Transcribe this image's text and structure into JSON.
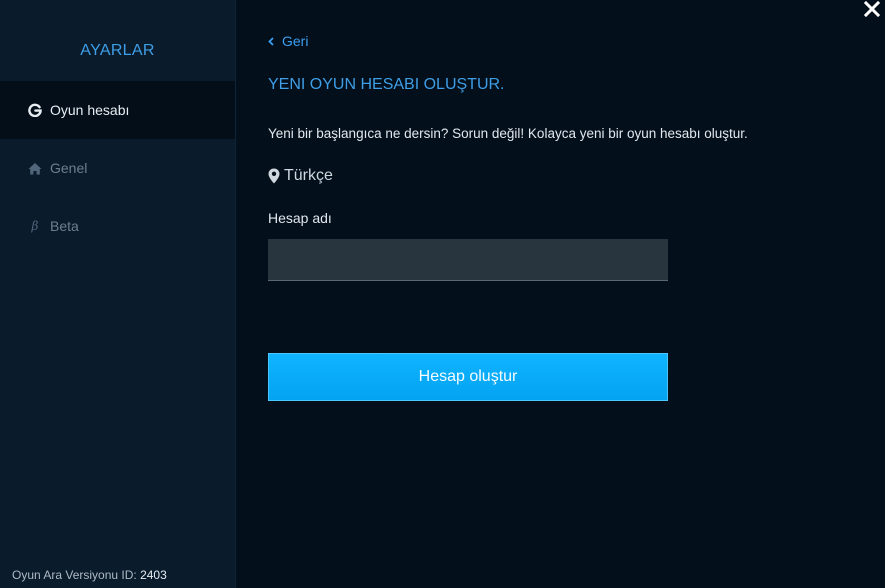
{
  "sidebar": {
    "title": "AYARLAR",
    "items": [
      {
        "label": "Oyun hesabı",
        "icon": "game-logo-icon",
        "active": true
      },
      {
        "label": "Genel",
        "icon": "home-icon",
        "active": false
      },
      {
        "label": "Beta",
        "icon": "beta-icon",
        "active": false
      }
    ],
    "beta_glyph": "β",
    "version_label": "Oyun Ara Versiyonu ID:",
    "version_value": "2403"
  },
  "header": {
    "close_icon": "close-icon"
  },
  "main": {
    "back_label": "Geri",
    "title": "YENI OYUN HESABI OLUŞTUR.",
    "description": "Yeni bir başlangıca ne dersin? Sorun değil! Kolayca yeni bir oyun hesabı oluştur.",
    "region": "Türkçe",
    "field_label": "Hesap adı",
    "field_value": "",
    "field_placeholder": "",
    "submit_label": "Hesap oluştur"
  },
  "colors": {
    "accent": "#3e9ee6",
    "button": "#08adfa",
    "sidebar_bg": "#0a1b2c",
    "main_bg": "#030f1b"
  }
}
